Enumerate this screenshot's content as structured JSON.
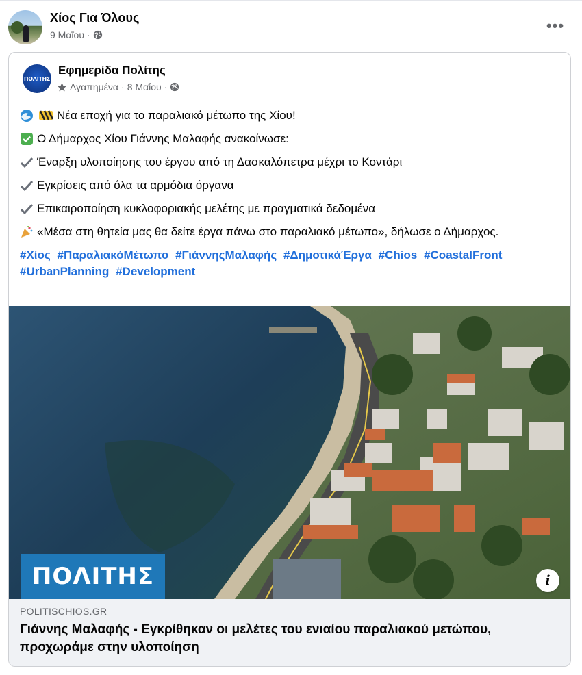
{
  "outer_post": {
    "author": "Χίος Για Όλους",
    "date": "9 Μαΐου"
  },
  "shared_post": {
    "page_name": "Εφημερίδα Πολίτης",
    "page_avatar_text": "ΠΟΛΙΤΗΣ",
    "favorites_label": "Αγαπημένα",
    "date": "8 Μαΐου",
    "lines": [
      "Νέα εποχή για το παραλιακό μέτωπο της Χίου!",
      "Ο Δήμαρχος Χίου Γιάννης Μαλαφής ανακοίνωσε:",
      "Έναρξη υλοποίησης του έργου από τη Δασκαλόπετρα μέχρι το Κοντάρι",
      "Εγκρίσεις από όλα τα αρμόδια όργανα",
      "Επικαιροποίηση κυκλοφοριακής μελέτης με πραγματικά δεδομένα",
      "«Μέσα στη θητεία μας θα δείτε έργα πάνω στο παραλιακό μέτωπο», δήλωσε ο Δήμαρχος."
    ],
    "hashtags": [
      "#Χίος",
      "#ΠαραλιακόΜέτωπο",
      "#ΓιάννηςΜαλαφής",
      "#ΔημοτικάΈργα",
      "#Chios",
      "#CoastalFront",
      "#UrbanPlanning",
      "#Development"
    ],
    "image_watermark": "ΠΟΛΙΤΗΣ",
    "link": {
      "domain": "POLITISCHIOS.GR",
      "title": "Γιάννης Μαλαφής - Εγκρίθηκαν οι μελέτες του ενιαίου παραλιακού μετώπου, προχωράμε στην υλοποίηση"
    }
  },
  "icons": {
    "more": "more-options-icon",
    "audience": "globe-icon",
    "favorites": "star-icon",
    "info": "info-icon"
  },
  "colors": {
    "hashtag": "#216fdb",
    "meta_text": "#65676b",
    "link_bg": "#f0f2f5",
    "watermark_bg": "#1f78b8"
  }
}
